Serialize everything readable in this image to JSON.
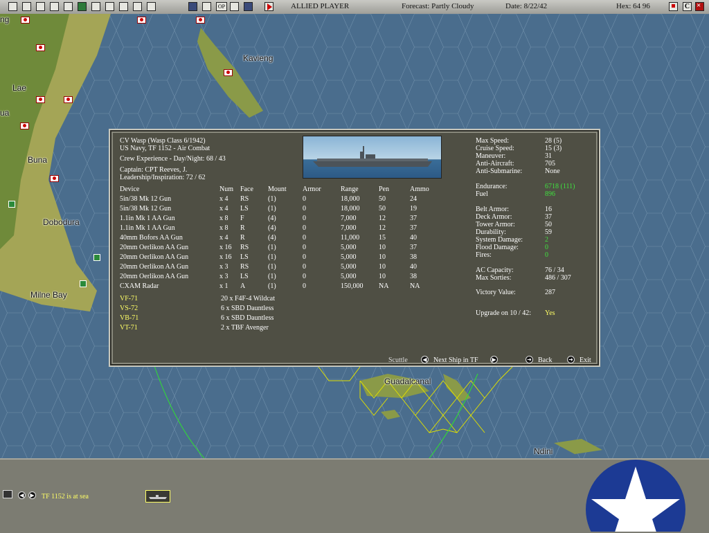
{
  "toolbar": {
    "player": "ALLIED PLAYER",
    "forecast": "Forecast: Partly Cloudy",
    "date": "Date: 8/22/42",
    "hex": "Hex: 64 96",
    "op_label": "OP",
    "c_label": "C"
  },
  "map": {
    "places": {
      "kavieng": "Kavieng",
      "lae": "Lae",
      "buna": "Buna",
      "dobodura": "Dobodura",
      "milne_bay": "Milne Bay",
      "guadalcanal": "Guadalcanal",
      "ndini": "Ndini",
      "edge_ng": "ng",
      "edge_ua": "ua"
    }
  },
  "ship": {
    "name": "CV Wasp (Wasp Class 6/1942)",
    "fleet": "US Navy, TF 1152 - Air Combat",
    "crew": "Crew Experience - Day/Night: 68 / 43",
    "captain": "Captain: CPT Reeves, J.",
    "leadership": "Leadership/Inspiration: 72 / 62",
    "headers": [
      "Device",
      "Num",
      "Face",
      "Mount",
      "Armor",
      "Range",
      "Pen",
      "Ammo"
    ],
    "devices": [
      [
        "5in/38 Mk 12 Gun",
        "x 4",
        "RS",
        "(1)",
        "0",
        "18,000",
        "50",
        "24"
      ],
      [
        "5in/38 Mk 12 Gun",
        "x 4",
        "LS",
        "(1)",
        "0",
        "18,000",
        "50",
        "19"
      ],
      [
        "1.1in Mk 1 AA Gun",
        "x 8",
        "F",
        "(4)",
        "0",
        "7,000",
        "12",
        "37"
      ],
      [
        "1.1in Mk 1 AA Gun",
        "x 8",
        "R",
        "(4)",
        "0",
        "7,000",
        "12",
        "37"
      ],
      [
        "40mm Bofors AA Gun",
        "x 4",
        "R",
        "(4)",
        "0",
        "11,000",
        "15",
        "40"
      ],
      [
        "20mm Oerlikon AA Gun",
        "x 16",
        "RS",
        "(1)",
        "0",
        "5,000",
        "10",
        "37"
      ],
      [
        "20mm Oerlikon AA Gun",
        "x 16",
        "LS",
        "(1)",
        "0",
        "5,000",
        "10",
        "38"
      ],
      [
        "20mm Oerlikon AA Gun",
        "x 3",
        "RS",
        "(1)",
        "0",
        "5,000",
        "10",
        "40"
      ],
      [
        "20mm Oerlikon AA Gun",
        "x 3",
        "LS",
        "(1)",
        "0",
        "5,000",
        "10",
        "38"
      ],
      [
        "CXAM Radar",
        "x 1",
        "A",
        "(1)",
        "0",
        "150,000",
        "NA",
        "NA"
      ]
    ],
    "squadrons": [
      [
        "VF-71",
        "20 x F4F-4 Wildcat"
      ],
      [
        "VS-72",
        "6 x SBD Dauntless"
      ],
      [
        "VB-71",
        "6 x SBD Dauntless"
      ],
      [
        "VT-71",
        "2 x TBF Avenger"
      ]
    ],
    "stats": {
      "max_speed_label": "Max Speed:",
      "max_speed": "28 (5)",
      "cruise_speed_label": "Cruise Speed:",
      "cruise_speed": "15 (3)",
      "maneuver_label": "Maneuver:",
      "maneuver": "31",
      "anti_aircraft_label": "Anti-Aircraft:",
      "anti_aircraft": "705",
      "anti_sub_label": "Anti-Submarine:",
      "anti_sub": "None",
      "endurance_label": "Endurance:",
      "endurance": "6718 (111)",
      "fuel_label": "Fuel",
      "fuel": "896",
      "belt_armor_label": "Belt Armor:",
      "belt_armor": "16",
      "deck_armor_label": "Deck Armor:",
      "deck_armor": "37",
      "tower_armor_label": "Tower Armor:",
      "tower_armor": "50",
      "durability_label": "Durability:",
      "durability": "59",
      "system_damage_label": "System Damage:",
      "system_damage": "2",
      "flood_damage_label": "Flood Damage:",
      "flood_damage": "0",
      "fires_label": "Fires:",
      "fires": "0",
      "ac_capacity_label": "AC Capacity:",
      "ac_capacity": "76 / 34",
      "max_sorties_label": "Max Sorties:",
      "max_sorties": "486 / 307",
      "victory_label": "Victory Value:",
      "victory": "287",
      "upgrade_label": "Upgrade on 10 / 42:",
      "upgrade": "Yes"
    },
    "buttons": {
      "scuttle": "Scuttle",
      "next_ship": "Next Ship in TF",
      "back": "Back",
      "exit": "Exit"
    }
  },
  "status": {
    "message": "TF 1152 is at sea"
  },
  "colors": {
    "panel": "#4f4f44",
    "highlight": "#ffff66",
    "good": "#3fe23f",
    "sea": "#4a6c8c"
  }
}
